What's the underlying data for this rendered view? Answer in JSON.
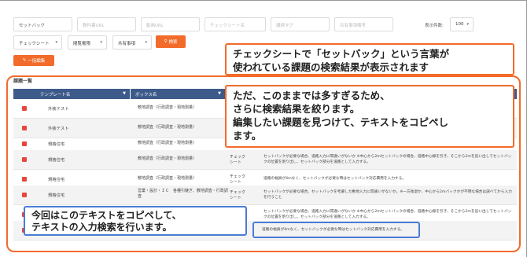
{
  "search": {
    "keyword_value": "セットバック",
    "url_placeholder": "教科書URL",
    "video_placeholder": "動画URL",
    "checksheet_placeholder": "チェックシート名",
    "tag_placeholder": "講師タグ",
    "doc_placeholder": "共有事項備考",
    "display_count_label": "表示件数:",
    "display_count_value": "100",
    "type_select": "チェックシート",
    "problem_select": "閲覧権限",
    "shared_select": "共有事項",
    "search_button": "検索",
    "bulk_edit_button": "一括編集"
  },
  "section_title": "課題一覧",
  "table": {
    "headers": [
      "テンプレート名",
      "ボックス名"
    ],
    "rows": [
      {
        "template": "外装テスト",
        "box": "敷地調査（行政調査・現地測量）",
        "type": "",
        "text": ""
      },
      {
        "template": "外装テスト",
        "box": "敷地調査（行政調査・現地測量）",
        "type": "",
        "text": ""
      },
      {
        "template": "規格住宅",
        "box": "敷地調査（行政調査・現地測量）",
        "type": "",
        "text": ""
      },
      {
        "template": "規格住宅",
        "box": "敷地調査（行政調査・現地測量）",
        "type": "チェック\nシート",
        "text": "セットバックが必要な場合、道路入力に間違いがないか ※中心から2mセットバックの場合、道路中心線を引き、そこから2mを追い出してセットバックの位置を割り出し、セットバック部分を道路として入力する。"
      },
      {
        "template": "規格住宅",
        "box": "敷地調査（行政調査・現地測量）",
        "type": "チェック\nシート",
        "text": "道路の幅員が4mなく、セットバックが必要な時はセットバック対応費用を入力する。"
      },
      {
        "template": "規格住宅",
        "box": "営業・設計・ＩＣ　各種引継ぎ、敷地調査・行政調査",
        "type": "チェック\nシート",
        "text": "セットバックが必要な場合、セットバックを考慮した敷地入力に間違いがないか。※一方後退か、中心から2mバックかが不明な場合は調べてから入力を行うこと"
      },
      {
        "template": "",
        "box": "",
        "type": "",
        "text": "セットバックが必要な場合、道路入力に間違いがないか ※中心から2mセットバックの場合、道路中心線を引き、そこから2mを追い出してセットバックの位置を割り出し、セットバック部分を道路として入力する。"
      },
      {
        "template": "",
        "box": "",
        "type": "",
        "text": "道路の幅員が4mなく、セットバックが必要な時はセットバック対応費用を入力する。"
      }
    ]
  },
  "callouts": {
    "top": "チェックシートで「セットバック」という言葉が\n使われている課題の検索結果が表示されます",
    "middle": "ただ、このままでは多すぎるため、\nさらに検索結果を絞ります。\n編集したい課題を見つけて、テキストをコピペし\nます。",
    "bottom": "今回はこのテキストをコピペして、\nテキストの入力検索を行います。"
  },
  "colors": {
    "accent": "#f26b2a",
    "header": "#3d5a8a",
    "highlight_blue": "#4a7bd4",
    "check_red": "#e8453c"
  }
}
